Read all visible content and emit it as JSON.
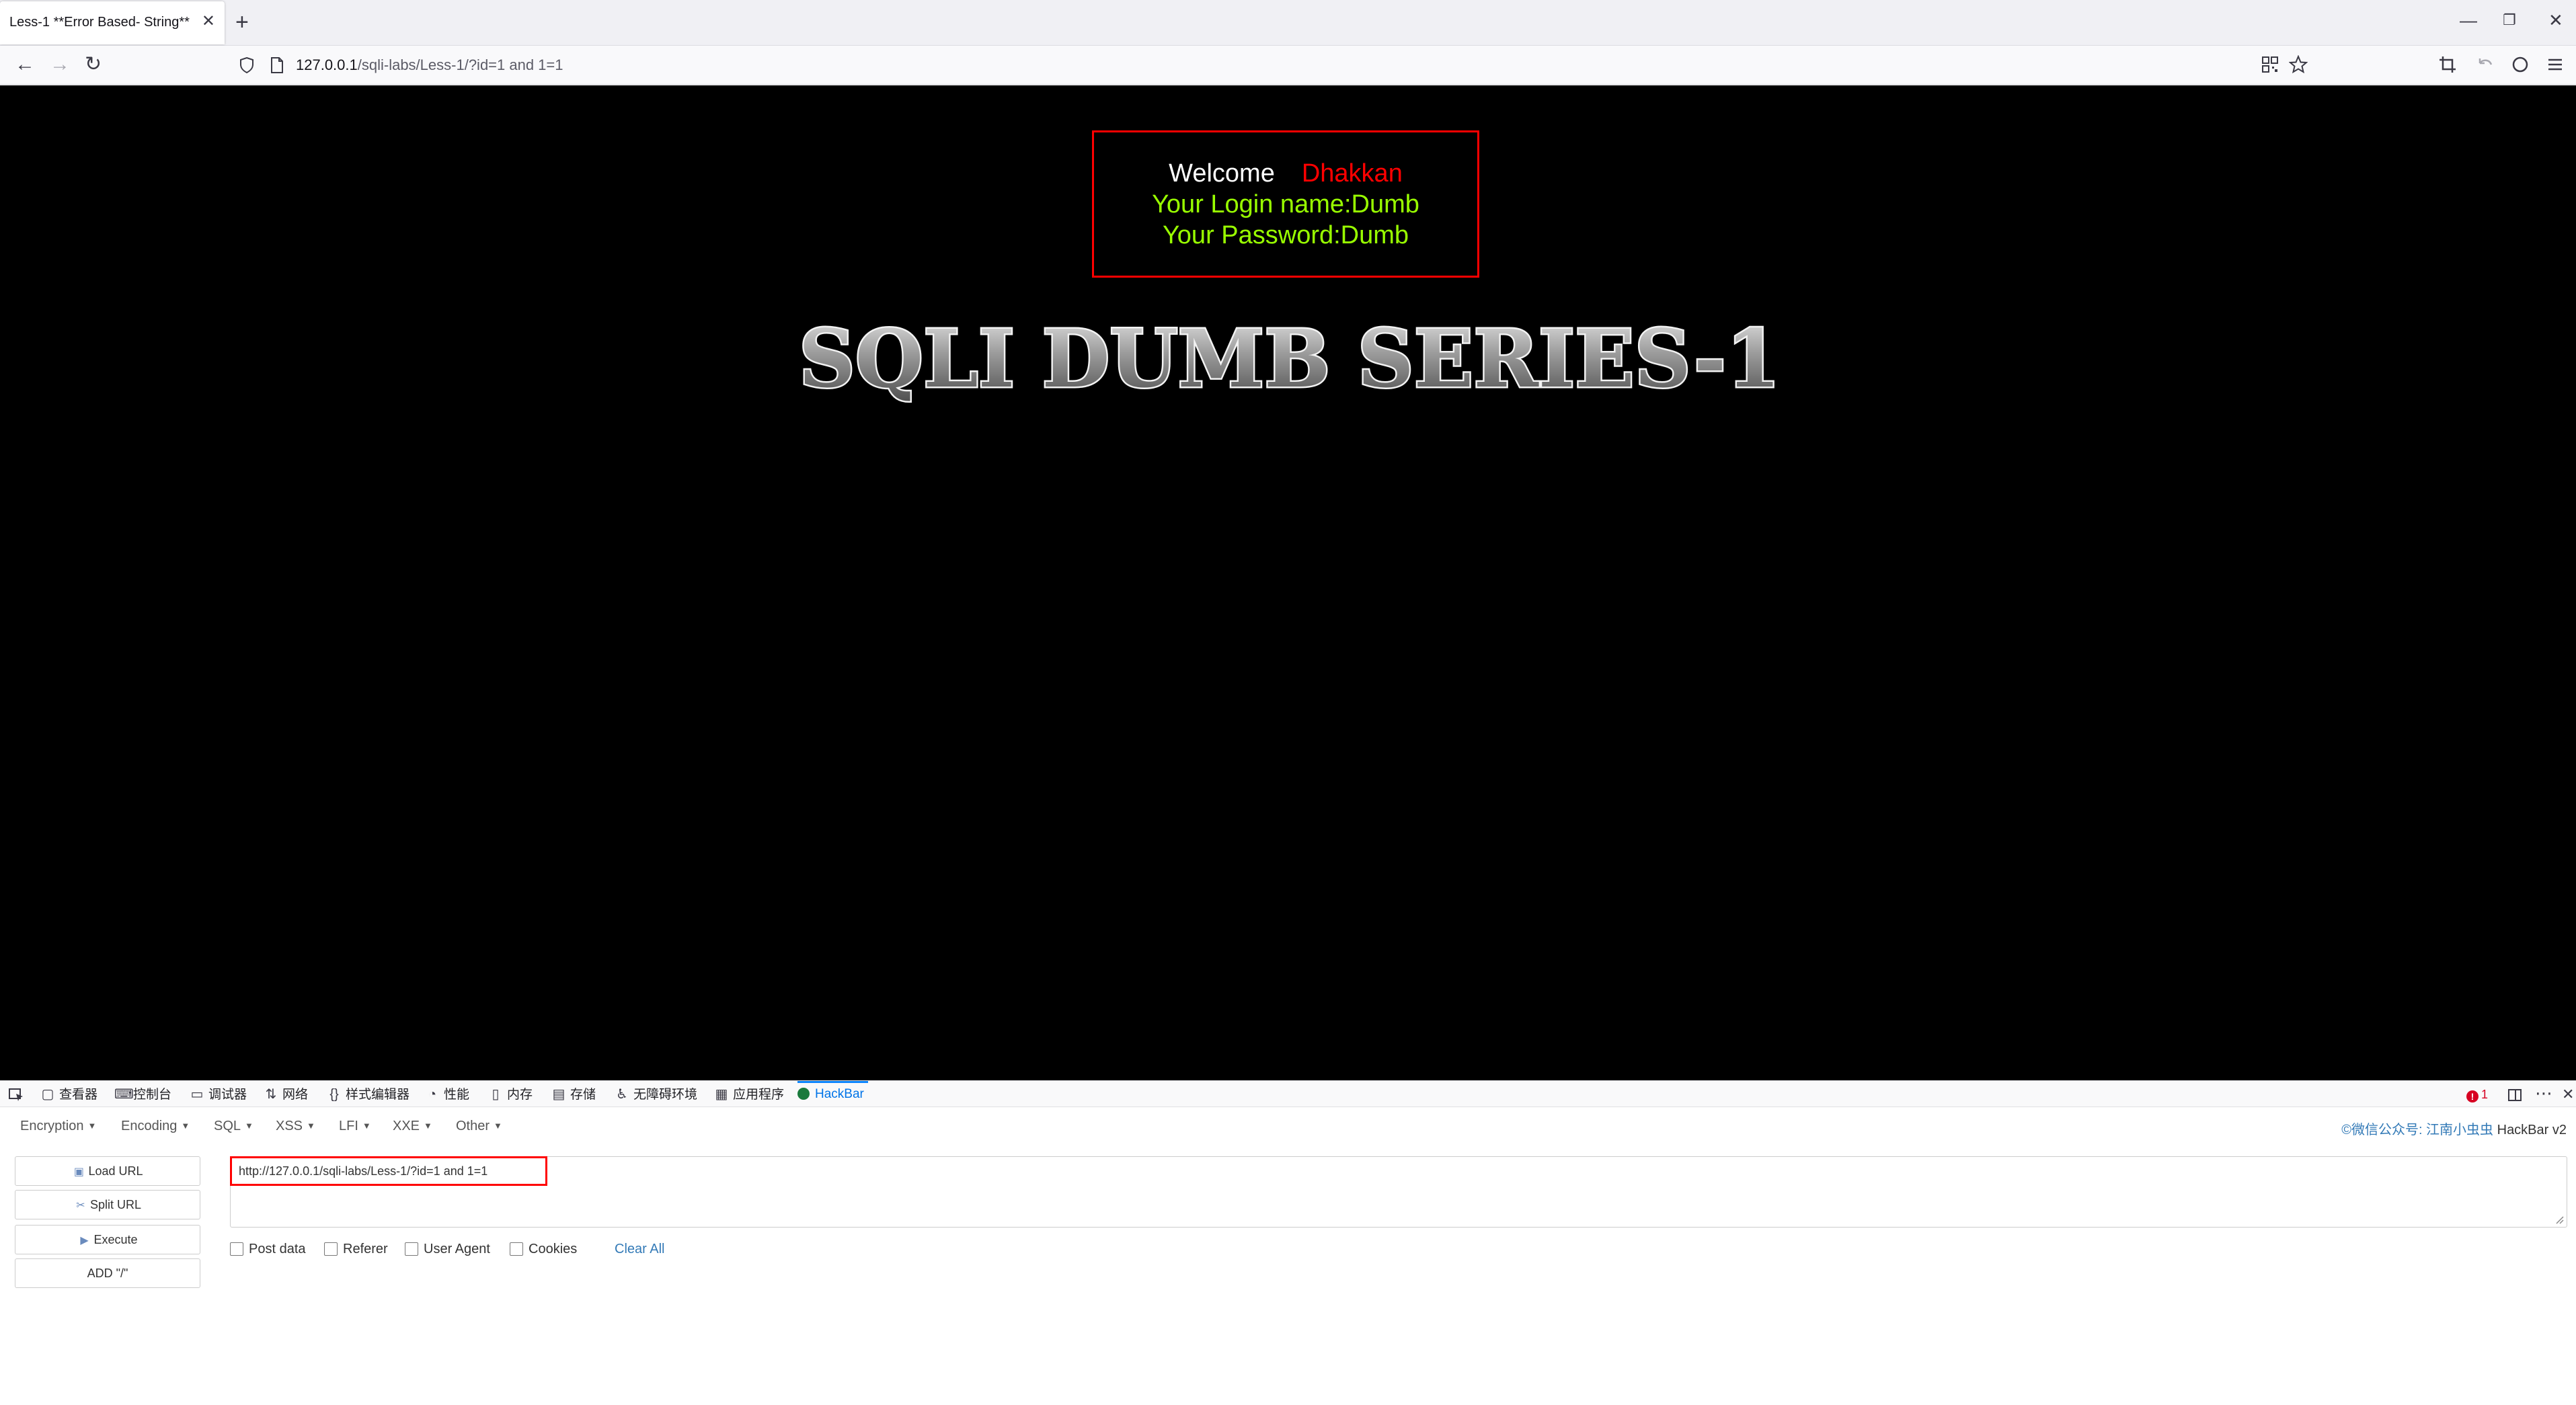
{
  "browser": {
    "tab_title": "Less-1 **Error Based- String**",
    "tab_close": "✕",
    "new_tab": "+",
    "window_controls": {
      "minimize": "—",
      "restore": "❐",
      "close": "✕"
    },
    "url": {
      "host": "127.0.0.1",
      "path": "/sqli-labs/Less-1/?id=1 and 1=1"
    }
  },
  "page": {
    "background": "#000000",
    "welcome_word": "Welcome",
    "welcome_name": "Dhakkan",
    "login_line": "Your Login name:Dumb",
    "password_line": "Your Password:Dumb",
    "series_title": "SQLI DUMB SERIES-1",
    "colors": {
      "box_border": "#ff0000",
      "name": "#ff0000",
      "login_text": "#99ff00"
    }
  },
  "devtools": {
    "tabs": [
      {
        "icon": "inspector-icon",
        "label": "查看器"
      },
      {
        "icon": "console-icon",
        "label": "控制台"
      },
      {
        "icon": "debugger-icon",
        "label": "调试器"
      },
      {
        "icon": "network-icon",
        "label": "网络"
      },
      {
        "icon": "style-editor-icon",
        "label": "样式编辑器"
      },
      {
        "icon": "performance-icon",
        "label": "性能"
      },
      {
        "icon": "memory-icon",
        "label": "内存"
      },
      {
        "icon": "storage-icon",
        "label": "存储"
      },
      {
        "icon": "accessibility-icon",
        "label": "无障碍环境"
      },
      {
        "icon": "application-icon",
        "label": "应用程序"
      },
      {
        "icon": "hackbar-icon",
        "label": "HackBar"
      }
    ],
    "active_tab": "HackBar",
    "error_count": "1"
  },
  "hackbar": {
    "menus": [
      "Encoding",
      "Encoding",
      "SQL",
      "XSS",
      "LFI",
      "XXE",
      "Other"
    ],
    "credit_blue": "©微信公众号: 江南小虫虫",
    "credit_rest": " HackBar v2",
    "buttons": {
      "load_url": "Load URL",
      "split_url": "Split URL",
      "execute": "Execute",
      "add_slash": "ADD \"/\""
    },
    "url_value": "http://127.0.0.1/sqli-labs/Less-1/?id=1 and 1=1",
    "checkboxes": [
      "Post data",
      "Referer",
      "User Agent",
      "Cookies"
    ],
    "clear_all": "Clear All"
  }
}
